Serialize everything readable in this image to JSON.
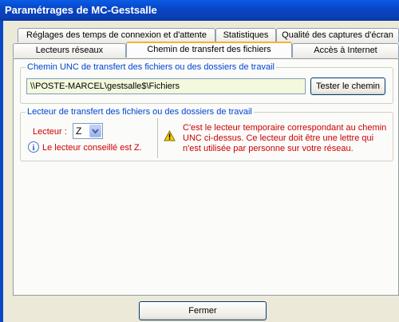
{
  "window": {
    "title": "Paramétrages de MC-Gestsalle"
  },
  "tabs": {
    "row_back": [
      "Réglages des temps de connexion et d'attente",
      "Statistiques",
      "Qualité des captures d'écran"
    ],
    "row_front": [
      "Lecteurs réseaux",
      "Chemin de transfert des fichiers",
      "Accès à Internet"
    ],
    "active": "Chemin de transfert des fichiers"
  },
  "unc_group": {
    "legend": "Chemin UNC de transfert des fichiers ou des dossiers de travail",
    "path_value": "\\\\POSTE-MARCEL\\gestsalle$\\Fichiers",
    "test_button": "Tester le chemin"
  },
  "drive_group": {
    "legend": "Lecteur de transfert des fichiers ou des dossiers de travail",
    "drive_label": "Lecteur :",
    "drive_value": "Z",
    "advice": "Le lecteur conseillé est Z.",
    "warning": "C'est le lecteur temporaire correspondant au chemin UNC ci-dessus. Ce lecteur doit être une lettre qui n'est utilisée par personne sur votre réseau."
  },
  "footer": {
    "close_button": "Fermer"
  },
  "colors": {
    "title_bar": "#0a48c6",
    "group_legend": "#0046d5",
    "warning_text": "#cc0000",
    "active_tab_accent": "#f5b330"
  },
  "icons": {
    "info": "info-icon",
    "warning": "warning-icon",
    "dropdown": "chevron-down-icon"
  }
}
